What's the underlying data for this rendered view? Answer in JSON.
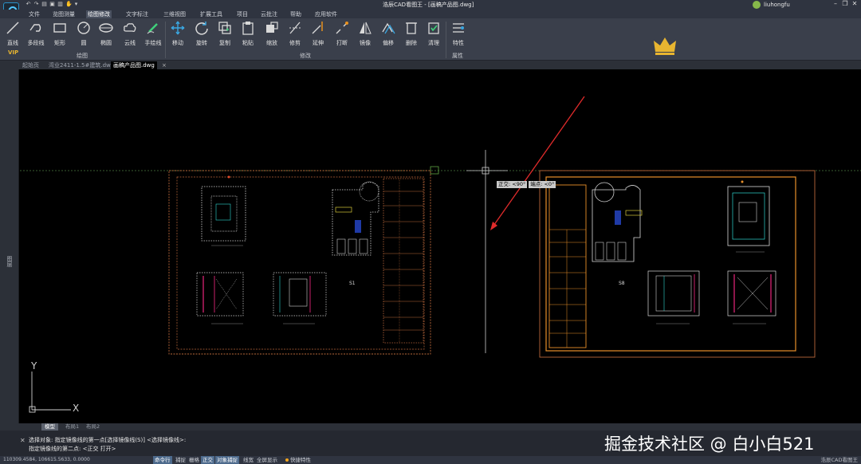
{
  "titlebar": {
    "title": "浩辰CAD看图王 - [画稿产品图.dwg]",
    "username": "liuhongfu"
  },
  "menu": {
    "tabs": [
      "文件",
      "览图测量",
      "绘图修改",
      "文字标注",
      "三维视图",
      "扩展工具",
      "项目",
      "云批注",
      "帮助",
      "应用软件"
    ],
    "active": "绘图修改"
  },
  "ribbon": {
    "draw_tools": [
      "直线",
      "多段线",
      "矩形",
      "圆",
      "椭圆",
      "云线",
      "手绘线"
    ],
    "modify_tools": [
      "移动",
      "旋转",
      "复制",
      "粘贴",
      "缩放",
      "修剪",
      "延伸",
      "打断",
      "镜像",
      "偏移",
      "删除",
      "清理"
    ],
    "property_tools": [
      "特性"
    ],
    "groups": {
      "draw": "绘图",
      "modify": "修改",
      "property": "属性"
    },
    "vip_label": "VIP"
  },
  "doc_tabs": [
    "起始页",
    "湾业2411-1.5#建筑.dwg",
    "画稿产品图.dwg"
  ],
  "doc_tab_active": "画稿产品图.dwg",
  "side_panel_label": "图层",
  "canvas": {
    "tooltip_ortho": "正交: <90°",
    "tooltip_polar": "端点: <0°",
    "axis_y": "Y",
    "axis_x": "X",
    "left_drawing_label": "S1",
    "right_drawing_label": "S8"
  },
  "layout_tabs": [
    "模型",
    "布局1",
    "布局2"
  ],
  "layout_tab_active": "模型",
  "command": {
    "line1": "选择对象:  指定镜像线的第一点[选择镜像线(S)] <选择镜像线>:",
    "line2": "指定镜像线的第二点: <正交 打开>"
  },
  "watermark": "掘金技术社区 @ 白小白521",
  "status": {
    "coords": "110309.4584, 106615.5633, 0.0000",
    "buttons": [
      "命令行",
      "捕捉",
      "栅格",
      "正交",
      "对象捕捉",
      "线宽",
      "全屏显示",
      "快捷特性"
    ],
    "active_buttons": [
      "命令行",
      "正交",
      "对象捕捉"
    ],
    "app_name": "浩辰CAD看图王"
  },
  "colors": {
    "accent": "#2a91c8",
    "drawing_frame": "#b9673a",
    "dim_magenta": "#c7206a",
    "cyan_detail": "#2fd6d0",
    "annotation_arrow": "#e02b2b",
    "vip_gold": "#e8b530"
  }
}
